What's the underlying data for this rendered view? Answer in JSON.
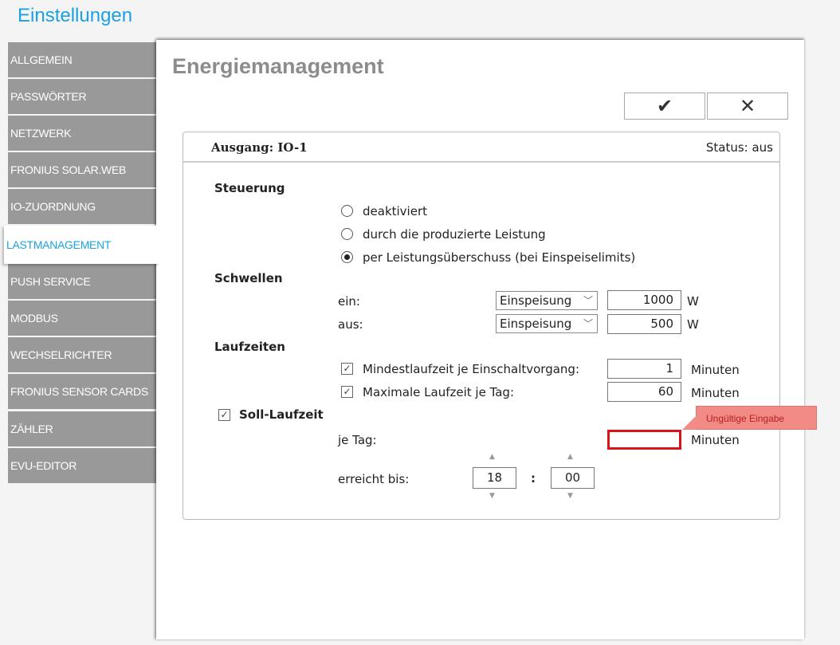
{
  "header": {
    "title": "Einstellungen"
  },
  "sidebar": {
    "items": [
      {
        "label": "ALLGEMEIN"
      },
      {
        "label": "PASSWÖRTER"
      },
      {
        "label": "NETZWERK"
      },
      {
        "label": "FRONIUS SOLAR.WEB"
      },
      {
        "label": "IO-ZUORDNUNG"
      },
      {
        "label": "LASTMANAGEMENT",
        "active": true
      },
      {
        "label": "PUSH SERVICE"
      },
      {
        "label": "MODBUS"
      },
      {
        "label": "WECHSELRICHTER"
      },
      {
        "label": "FRONIUS SENSOR CARDS"
      },
      {
        "label": "ZÄHLER"
      },
      {
        "label": "EVU-EDITOR"
      }
    ]
  },
  "main": {
    "title": "Energiemanagement",
    "confirm_icon": "✔",
    "cancel_icon": "✕",
    "output_label": "Ausgang: IO-1",
    "status_label": "Status:",
    "status_value": "aus",
    "steuerung": {
      "title": "Steuerung",
      "options": [
        "deaktiviert",
        "durch die produzierte Leistung",
        "per Leistungsüberschuss (bei Einspeiselimits)"
      ],
      "selected": 2
    },
    "schwellen": {
      "title": "Schwellen",
      "ein_label": "ein:",
      "aus_label": "aus:",
      "ein_mode": "Einspeisung",
      "aus_mode": "Einspeisung",
      "ein_value": "1000",
      "aus_value": "500",
      "unit": "W"
    },
    "laufzeiten": {
      "title": "Laufzeiten",
      "min_label": "Mindestlaufzeit je Einschaltvorgang:",
      "min_value": "1",
      "max_label": "Maximale Laufzeit je Tag:",
      "max_value": "60",
      "unit": "Minuten"
    },
    "soll": {
      "title": "Soll-Laufzeit",
      "per_day_label": "je Tag:",
      "per_day_value": "",
      "unit": "Minuten",
      "error": "Ungültige Eingabe",
      "reached_label": "erreicht bis:",
      "hour": "18",
      "minute": "00",
      "sep": ":"
    }
  }
}
